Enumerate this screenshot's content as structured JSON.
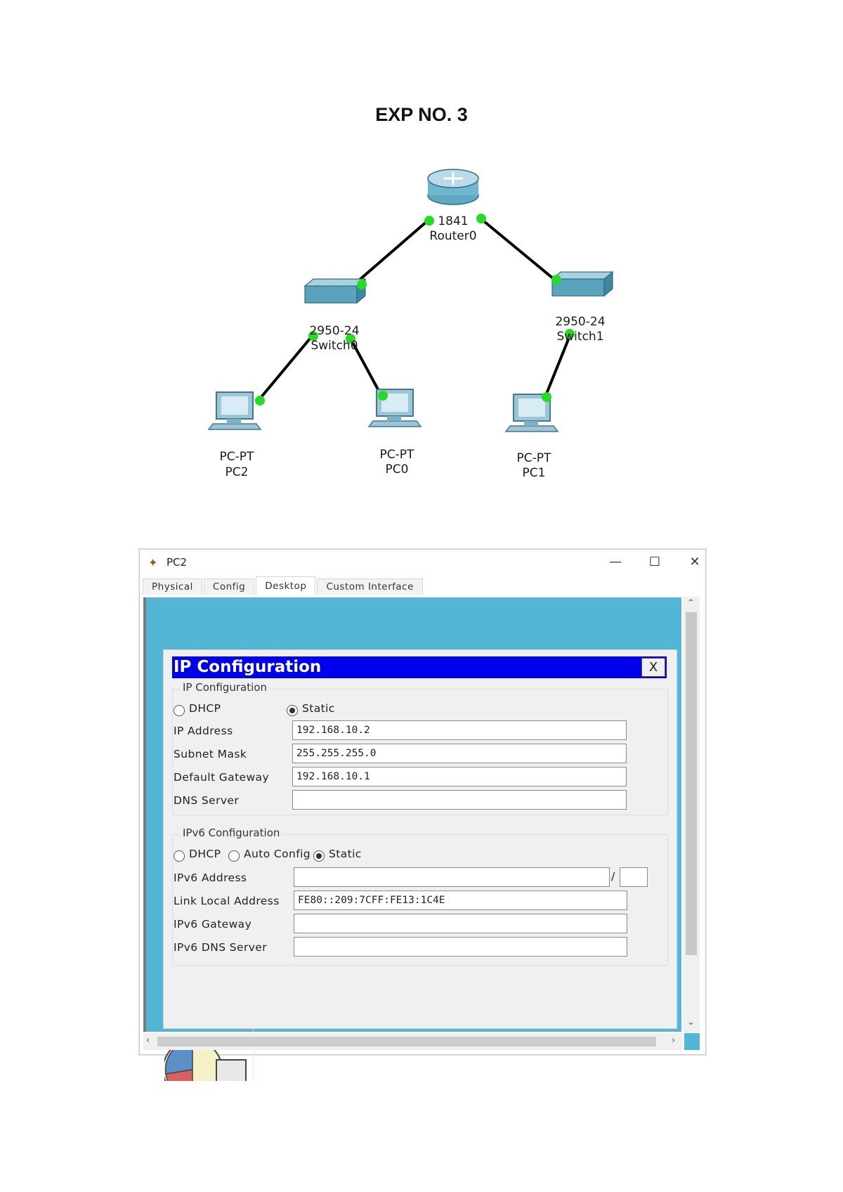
{
  "document": {
    "title": "EXP NO. 3"
  },
  "topology": {
    "nodes": [
      {
        "id": "router0",
        "type": "router",
        "model": "1841",
        "name": "Router0"
      },
      {
        "id": "switch0",
        "type": "switch",
        "model": "2950-24",
        "name": "Switch0"
      },
      {
        "id": "switch1",
        "type": "switch",
        "model": "2950-24",
        "name": "Switch1"
      },
      {
        "id": "pc2",
        "type": "pc",
        "model": "PC-PT",
        "name": "PC2"
      },
      {
        "id": "pc0",
        "type": "pc",
        "model": "PC-PT",
        "name": "PC0"
      },
      {
        "id": "pc1",
        "type": "pc",
        "model": "PC-PT",
        "name": "PC1"
      }
    ],
    "links": [
      {
        "from": "router0",
        "to": "switch0",
        "status": "up"
      },
      {
        "from": "router0",
        "to": "switch1",
        "status": "up"
      },
      {
        "from": "switch0",
        "to": "pc2",
        "status": "up"
      },
      {
        "from": "switch0",
        "to": "pc0",
        "status": "up"
      },
      {
        "from": "switch1",
        "to": "pc1",
        "status": "up"
      }
    ],
    "link_up_color": "#22dd22"
  },
  "window": {
    "title": "PC2",
    "icon": "packet-tracer-icon",
    "controls": {
      "minimize": "—",
      "maximize": "☐",
      "close": "✕"
    },
    "tabs": [
      {
        "label": "Physical",
        "active": false
      },
      {
        "label": "Config",
        "active": false
      },
      {
        "label": "Desktop",
        "active": true
      },
      {
        "label": "Custom Interface",
        "active": false
      }
    ]
  },
  "dialog": {
    "title": "IP Configuration",
    "close_label": "X",
    "header_color": "#0000ee",
    "desktop_color": "#52b6d4",
    "ipv4": {
      "legend": "IP Configuration",
      "dhcp_label": "DHCP",
      "static_label": "Static",
      "mode": "Static",
      "ip_label": "IP Address",
      "ip_value": "192.168.10.2",
      "mask_label": "Subnet Mask",
      "mask_value": "255.255.255.0",
      "gateway_label": "Default Gateway",
      "gateway_value": "192.168.10.1",
      "dns_label": "DNS Server",
      "dns_value": ""
    },
    "ipv6": {
      "legend": "IPv6 Configuration",
      "dhcp_label": "DHCP",
      "auto_label": "Auto Config",
      "static_label": "Static",
      "mode": "Static",
      "address_label": "IPv6 Address",
      "address_value": "",
      "prefix_sep": "/",
      "prefix_value": "",
      "link_local_label": "Link Local Address",
      "link_local_value": "FE80::209:7CFF:FE13:1C4E",
      "gateway_label": "IPv6 Gateway",
      "gateway_value": "",
      "dns_label": "IPv6 DNS Server",
      "dns_value": ""
    }
  },
  "scrollbars": {
    "up": "⌃",
    "down": "⌄",
    "left": "‹",
    "right": "›"
  }
}
